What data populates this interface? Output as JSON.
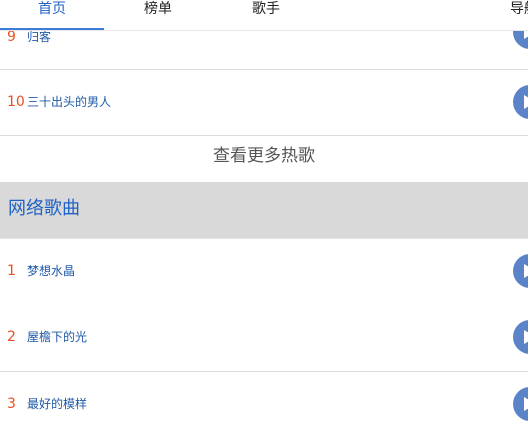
{
  "tabs": [
    {
      "label": "首页",
      "active": true
    },
    {
      "label": "榜单",
      "active": false
    },
    {
      "label": "歌手",
      "active": false
    },
    {
      "label": "导航",
      "active": false
    }
  ],
  "hot_songs": [
    {
      "rank": "9",
      "title": "归客"
    },
    {
      "rank": "10",
      "title": "三十出头的男人"
    }
  ],
  "more_label": "查看更多热歌",
  "network_section": {
    "title": "网络歌曲",
    "songs": [
      {
        "rank": "1",
        "title": "梦想水晶"
      },
      {
        "rank": "2",
        "title": "屋檐下的光"
      },
      {
        "rank": "3",
        "title": "最好的模样"
      }
    ]
  },
  "colors": {
    "accent": "#1f62c6",
    "rank": "#e8511f",
    "song_title": "#1f5aa6",
    "play_button": "#5b83c8",
    "section_bg": "#d9d9d9"
  },
  "icons": {
    "play_button": "play-icon"
  }
}
